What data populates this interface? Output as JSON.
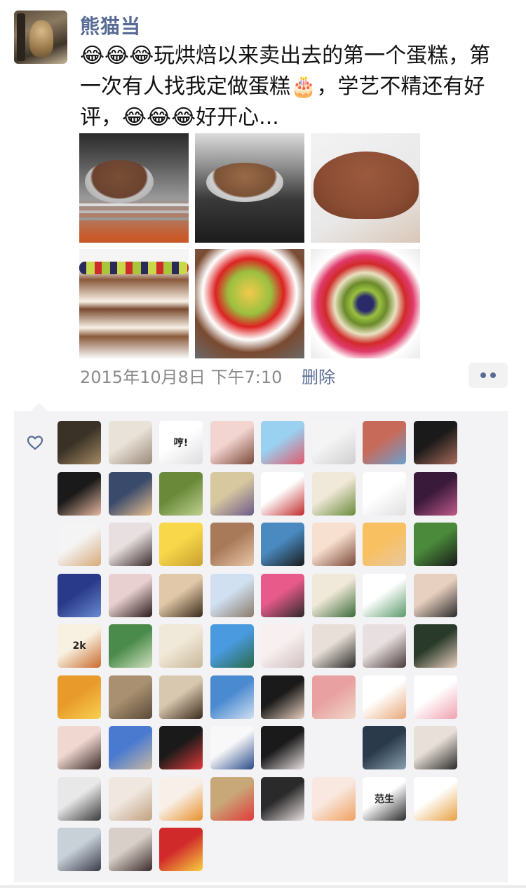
{
  "post": {
    "username": "熊猫当",
    "text": "😂😂😂玩烘焙以来卖出去的第一个蛋糕，第一次有人找我定做蛋糕🎂，学艺不精还有好评，😂😂😂好开心...",
    "timestamp": "2015年10月8日 下午7:10",
    "delete_label": "删除",
    "photos": [
      {
        "name": "cake-in-oven-photo",
        "style": "p-oven"
      },
      {
        "name": "cake-baking-photo",
        "style": "p-oven2"
      },
      {
        "name": "cake-base-photo",
        "style": "p-cakeout"
      },
      {
        "name": "layered-cake-photo",
        "style": "p-layer"
      },
      {
        "name": "fruit-cake-side-photo",
        "style": "p-top"
      },
      {
        "name": "fruit-cake-top-photo",
        "style": "p-top2"
      }
    ]
  },
  "likes": {
    "icon": "heart-icon",
    "accent_color": "#576b95",
    "avatars": [
      {
        "colors": [
          "#3a3226",
          "#a48a64"
        ],
        "text": ""
      },
      {
        "colors": [
          "#e9e2d8",
          "#9a8a7a"
        ],
        "text": ""
      },
      {
        "colors": [
          "#ffffff",
          "#dddddd"
        ],
        "text": "哼!"
      },
      {
        "colors": [
          "#f2d4d0",
          "#7a4a3a"
        ],
        "text": ""
      },
      {
        "colors": [
          "#9ad0f0",
          "#e05a6a"
        ],
        "text": ""
      },
      {
        "colors": [
          "#f4f4f4",
          "#cfcfcf"
        ],
        "text": ""
      },
      {
        "colors": [
          "#c86a5a",
          "#6aa0d0"
        ],
        "text": ""
      },
      {
        "colors": [
          "#1a1a1a",
          "#a86a5a"
        ],
        "text": ""
      },
      {
        "colors": [
          "#1a1a1a",
          "#e8b8a0"
        ],
        "text": ""
      },
      {
        "colors": [
          "#3a4a6a",
          "#e8c090"
        ],
        "text": ""
      },
      {
        "colors": [
          "#6a8a3a",
          "#c0d090"
        ],
        "text": ""
      },
      {
        "colors": [
          "#d8c8a0",
          "#6a5a8a"
        ],
        "text": ""
      },
      {
        "colors": [
          "#ffffff",
          "#c02a2a"
        ],
        "text": ""
      },
      {
        "colors": [
          "#f0e8d8",
          "#6a8a3a"
        ],
        "text": ""
      },
      {
        "colors": [
          "#ffffff",
          "#e0e0e0"
        ],
        "text": ""
      },
      {
        "colors": [
          "#3a1a3a",
          "#c05a8a"
        ],
        "text": ""
      },
      {
        "colors": [
          "#f4f4f4",
          "#d8a878"
        ],
        "text": ""
      },
      {
        "colors": [
          "#e8e0e0",
          "#3a2a2a"
        ],
        "text": ""
      },
      {
        "colors": [
          "#f8d84a",
          "#c8a030"
        ],
        "text": ""
      },
      {
        "colors": [
          "#a87a5a",
          "#e8c8a8"
        ],
        "text": ""
      },
      {
        "colors": [
          "#4a8ac0",
          "#1a1a1a"
        ],
        "text": ""
      },
      {
        "colors": [
          "#f8e0d0",
          "#7a4a3a"
        ],
        "text": ""
      },
      {
        "colors": [
          "#f8c060",
          "#e8c8a0"
        ],
        "text": ""
      },
      {
        "colors": [
          "#4a8a3a",
          "#1a1a1a"
        ],
        "text": ""
      },
      {
        "colors": [
          "#2a3a8a",
          "#6a8ad0"
        ],
        "text": ""
      },
      {
        "colors": [
          "#e8d0d0",
          "#2a1a1a"
        ],
        "text": ""
      },
      {
        "colors": [
          "#e0c8a8",
          "#3a2a1a"
        ],
        "text": ""
      },
      {
        "colors": [
          "#d0e0f0",
          "#8a7a6a"
        ],
        "text": ""
      },
      {
        "colors": [
          "#e85a8a",
          "#2a2a2a"
        ],
        "text": ""
      },
      {
        "colors": [
          "#f0e8d8",
          "#3a6a3a"
        ],
        "text": ""
      },
      {
        "colors": [
          "#ffffff",
          "#5a9a6a"
        ],
        "text": ""
      },
      {
        "colors": [
          "#e8d0c0",
          "#2a2a2a"
        ],
        "text": ""
      },
      {
        "colors": [
          "#f8f0e0",
          "#c86a2a"
        ],
        "text": "2k"
      },
      {
        "colors": [
          "#4a8a4a",
          "#d0e0c0"
        ],
        "text": ""
      },
      {
        "colors": [
          "#f0e8d8",
          "#c8b89a"
        ],
        "text": ""
      },
      {
        "colors": [
          "#4a9ae0",
          "#2a6a4a"
        ],
        "text": ""
      },
      {
        "colors": [
          "#f8f0f0",
          "#d0c0c0"
        ],
        "text": ""
      },
      {
        "colors": [
          "#e8e0d8",
          "#2a2a2a"
        ],
        "text": ""
      },
      {
        "colors": [
          "#e8e0e0",
          "#4a3a3a"
        ],
        "text": ""
      },
      {
        "colors": [
          "#2a3a2a",
          "#e8d0c0"
        ],
        "text": ""
      },
      {
        "colors": [
          "#e89a2a",
          "#f8d050"
        ],
        "text": ""
      },
      {
        "colors": [
          "#a89070",
          "#5a4a3a"
        ],
        "text": ""
      },
      {
        "colors": [
          "#d8c8b0",
          "#3a2a1a"
        ],
        "text": ""
      },
      {
        "colors": [
          "#4a8ad0",
          "#d0e0f0"
        ],
        "text": ""
      },
      {
        "colors": [
          "#1a1a1a",
          "#e8d0c0"
        ],
        "text": ""
      },
      {
        "colors": [
          "#e8a0a0",
          "#f0d8c8"
        ],
        "text": ""
      },
      {
        "colors": [
          "#ffffff",
          "#e8a87a"
        ],
        "text": ""
      },
      {
        "colors": [
          "#ffffff",
          "#f0a0b0"
        ],
        "text": ""
      },
      {
        "colors": [
          "#f0d8d0",
          "#3a2a2a"
        ],
        "text": ""
      },
      {
        "colors": [
          "#4a7ad0",
          "#c8b8a0"
        ],
        "text": ""
      },
      {
        "colors": [
          "#1a1a1a",
          "#e03a3a"
        ],
        "text": ""
      },
      {
        "colors": [
          "#f8f8f8",
          "#2a4a8a"
        ],
        "text": ""
      },
      {
        "colors": [
          "#1a1a1a",
          "#e8e0e0"
        ],
        "text": ""
      },
      {
        "colors": [
          "#f3f3f5",
          "#f3f3f5"
        ],
        "text": ""
      },
      {
        "colors": [
          "#2a3a4a",
          "#8aa0b0"
        ],
        "text": ""
      },
      {
        "colors": [
          "#e8e0d8",
          "#2a2a2a"
        ],
        "text": ""
      },
      {
        "colors": [
          "#e8e8e8",
          "#3a3a3a"
        ],
        "text": ""
      },
      {
        "colors": [
          "#f0e8e0",
          "#c0a080"
        ],
        "text": ""
      },
      {
        "colors": [
          "#f8f0e8",
          "#e8902a"
        ],
        "text": ""
      },
      {
        "colors": [
          "#c8a878",
          "#e03a3a"
        ],
        "text": ""
      },
      {
        "colors": [
          "#2a2a2a",
          "#e8e0e0"
        ],
        "text": ""
      },
      {
        "colors": [
          "#f8e8e0",
          "#f0a060"
        ],
        "text": ""
      },
      {
        "colors": [
          "#ffffff",
          "#2a2a2a"
        ],
        "text": "范生"
      },
      {
        "colors": [
          "#ffffff",
          "#e8a040"
        ],
        "text": ""
      },
      {
        "colors": [
          "#c8d0d8",
          "#3a3a4a"
        ],
        "text": ""
      },
      {
        "colors": [
          "#d8d0c8",
          "#3a2a2a"
        ],
        "text": ""
      },
      {
        "colors": [
          "#d02a2a",
          "#f8d040"
        ],
        "text": ""
      }
    ]
  }
}
